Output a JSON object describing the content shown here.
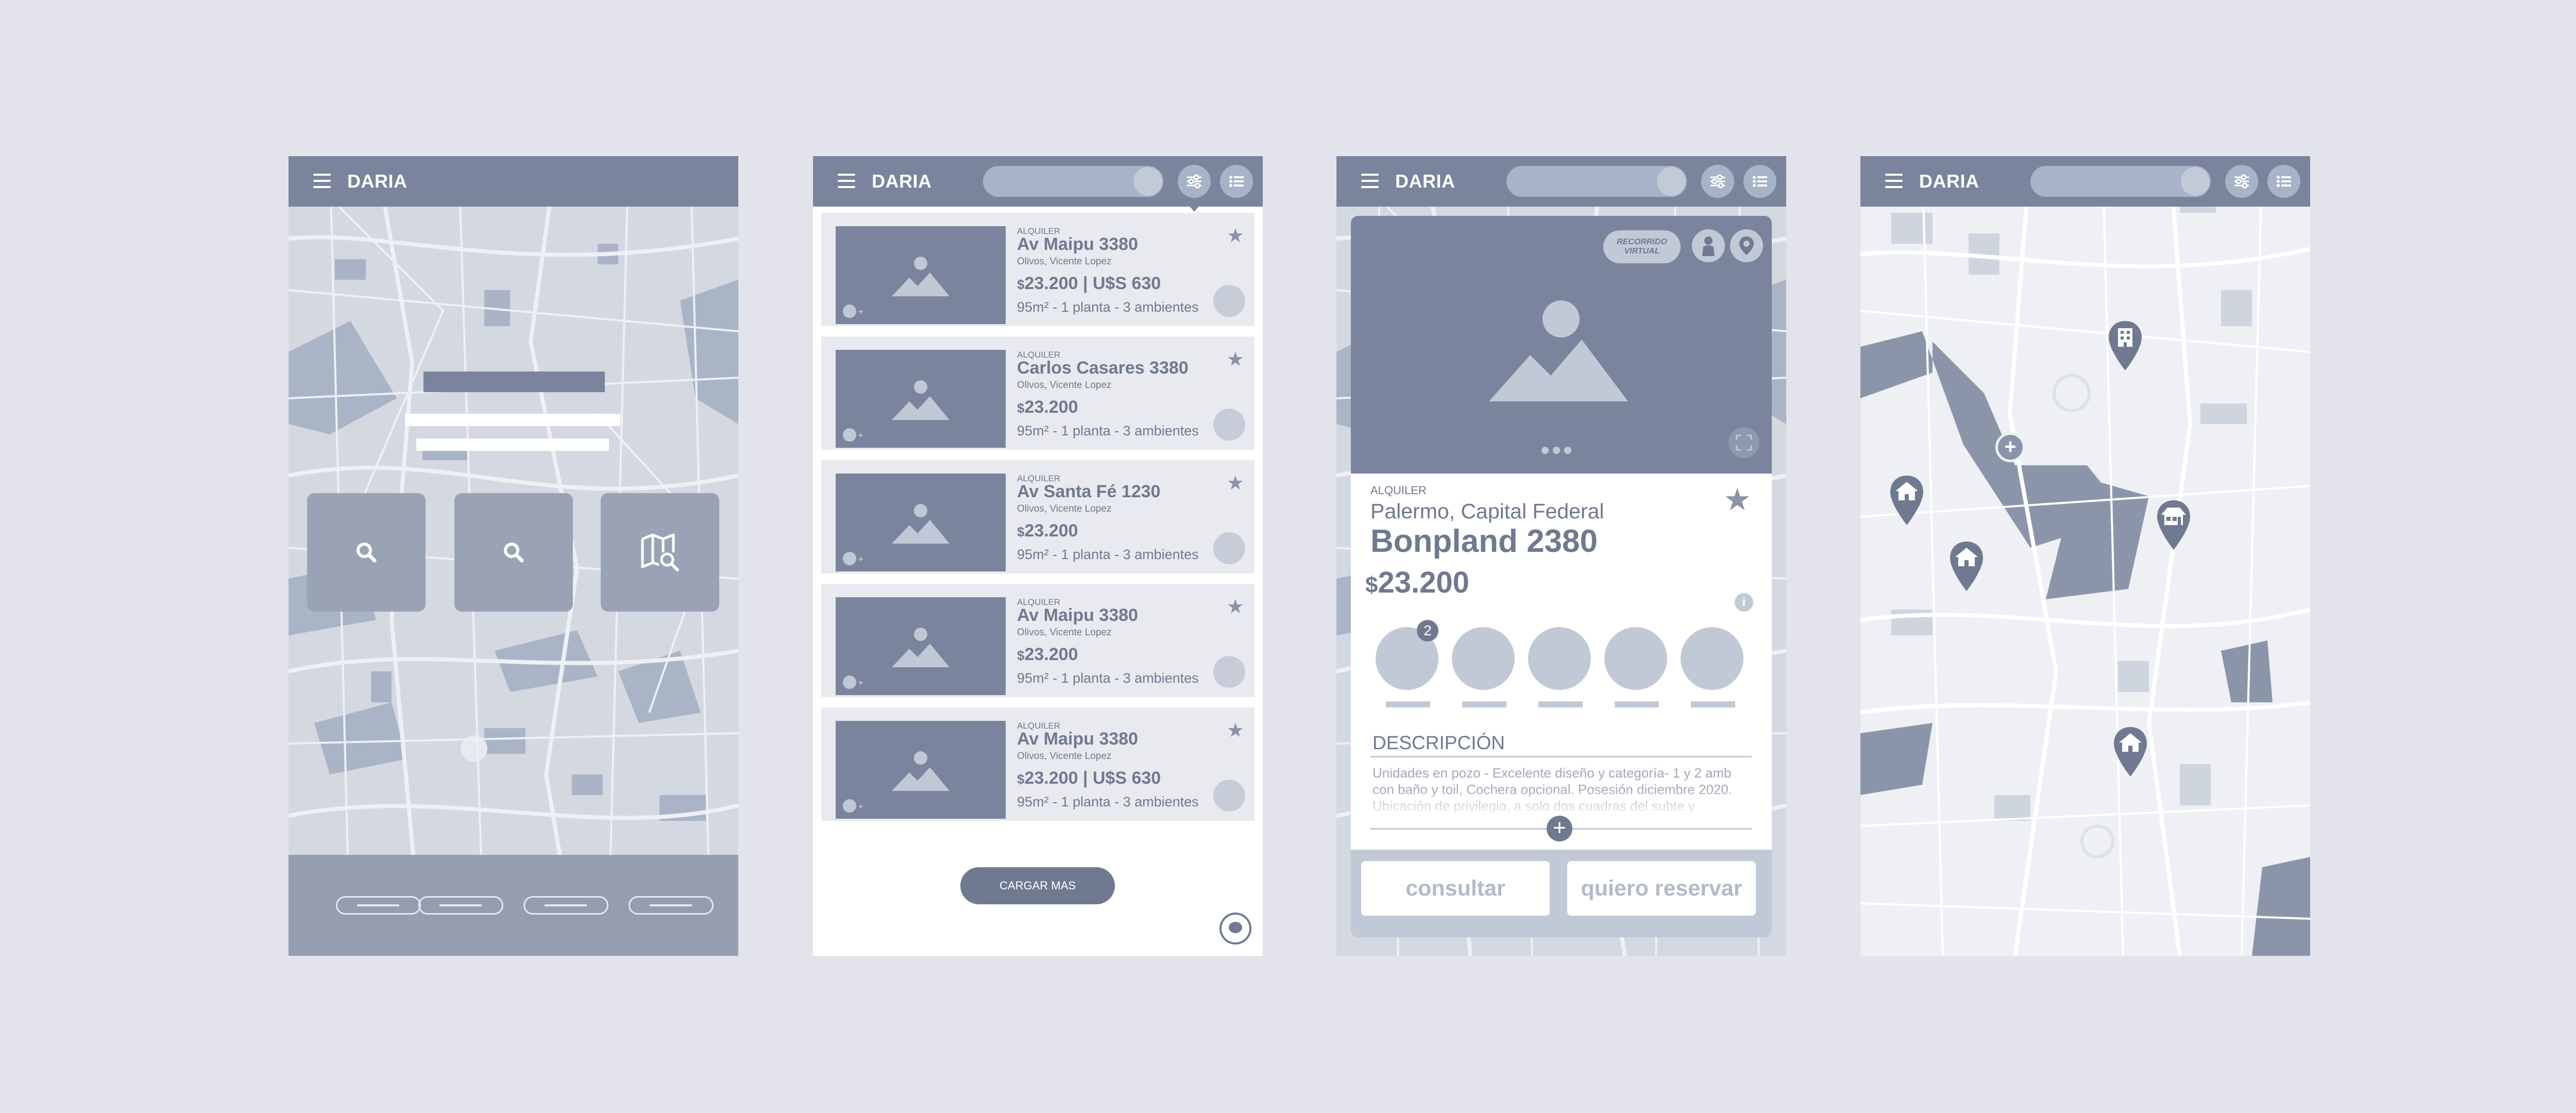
{
  "app": {
    "brand": "DARIA"
  },
  "colors": {
    "primary": "#7a849d",
    "dark": "#6f7990",
    "light": "#c2c9d6",
    "background": "#e3e4eb"
  },
  "home": {
    "tiles": [
      {
        "icon": "search-icon"
      },
      {
        "icon": "search-icon"
      },
      {
        "icon": "map-search-icon"
      }
    ],
    "footer_links": 4
  },
  "listing": {
    "cards": [
      {
        "kind": "ALQUILER",
        "title": "Av Maipu 3380",
        "location": "Olivos, Vicente Lopez",
        "price_currency": "$",
        "price": "23.200",
        "price_extra": " | U$S 630",
        "features": "95m² - 1 planta - 3 ambientes"
      },
      {
        "kind": "ALQUILER",
        "title": "Carlos Casares 3380",
        "location": "Olivos, Vicente Lopez",
        "price_currency": "$",
        "price": "23.200",
        "price_extra": "",
        "features": "95m² - 1 planta - 3 ambientes"
      },
      {
        "kind": "ALQUILER",
        "title": "Av Santa Fé 1230",
        "location": "Olivos, Vicente Lopez",
        "price_currency": "$",
        "price": "23.200",
        "price_extra": "",
        "features": "95m² - 1 planta - 3 ambientes"
      },
      {
        "kind": "ALQUILER",
        "title": "Av Maipu 3380",
        "location": "Olivos, Vicente Lopez",
        "price_currency": "$",
        "price": "23.200",
        "price_extra": "",
        "features": "95m² - 1 planta - 3 ambientes"
      },
      {
        "kind": "ALQUILER",
        "title": "Av Maipu 3380",
        "location": "Olivos, Vicente Lopez",
        "price_currency": "$",
        "price": "23.200",
        "price_extra": " | U$S 630",
        "features": "95m² - 1 planta - 3 ambientes"
      }
    ],
    "load_more": "CARGAR MAS"
  },
  "detail": {
    "virtual_tour": "RECORRIDO VIRTUAL",
    "kind": "ALQUILER",
    "location": "Palermo, Capital Federal",
    "title": "Bonpland 2380",
    "price_currency": "$",
    "price": "23.200",
    "photo_badge": "2",
    "info_icon": "i",
    "description_heading": "DESCRIPCIÓN",
    "description": "Unidades en pozo - Excelente diseño y categoría- 1 y 2 amb con baño y toil, Cochera opcional. Posesión diciembre 2020. Ubicación de privilegio, a solo dos cuadras del subte y",
    "more": "+",
    "consult_button": "consultar",
    "reserve_button": "quiero reservar"
  },
  "map": {
    "pins": [
      {
        "icon": "building-icon"
      },
      {
        "icon": "house-icon"
      },
      {
        "icon": "store-icon"
      },
      {
        "icon": "house-icon"
      },
      {
        "icon": "house-icon"
      }
    ]
  }
}
